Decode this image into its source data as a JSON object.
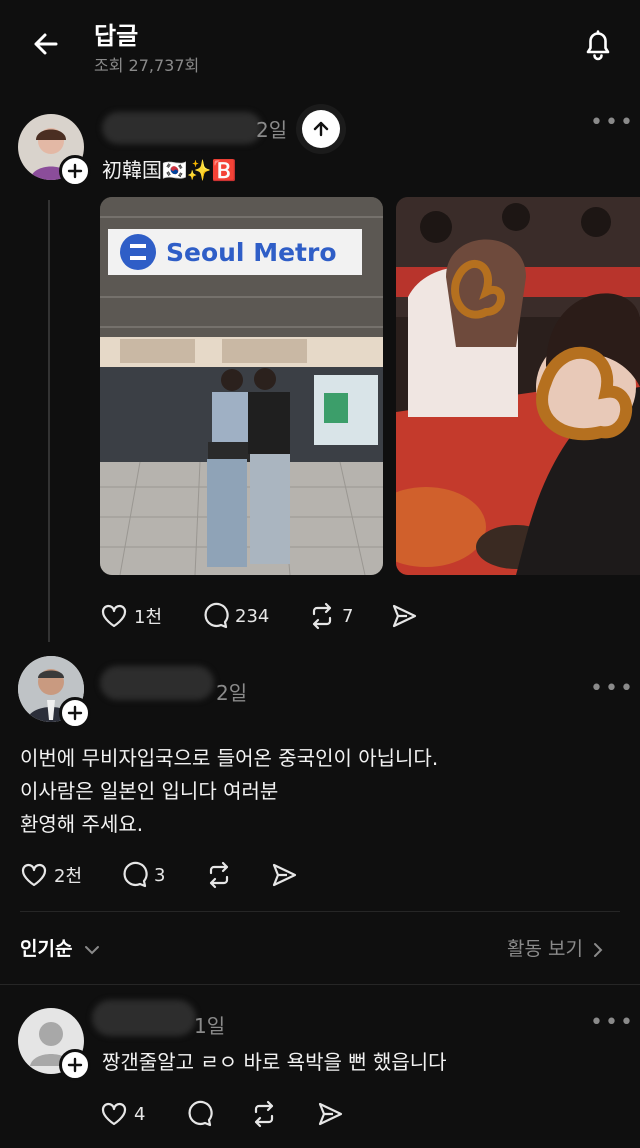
{
  "header": {
    "title": "답글",
    "views": "조회 27,737회"
  },
  "post1": {
    "time": "2일",
    "caption": "初韓国🇰🇷✨🅱️",
    "photo1_sign": "Seoul Metro",
    "likes": "1천",
    "comments": "234",
    "reposts": "7"
  },
  "post2": {
    "time": "2일",
    "lines": [
      "이번에 무비자입국으로 들어온 중국인이 아닙니다.",
      "이사람은 일본인 입니다 여러분",
      "환영해 주세요."
    ],
    "likes": "2천",
    "comments": "3"
  },
  "sort": {
    "label": "인기순",
    "activity": "활동 보기"
  },
  "reply": {
    "time": "1일",
    "text": "짱갠줄알고 ㄹㅇ 바로 욕박을 뻔 했읍니다",
    "likes": "4"
  },
  "colors": {
    "background": "#0f0f0f",
    "muted": "#8a8a8a",
    "text": "#f2f2f2"
  }
}
